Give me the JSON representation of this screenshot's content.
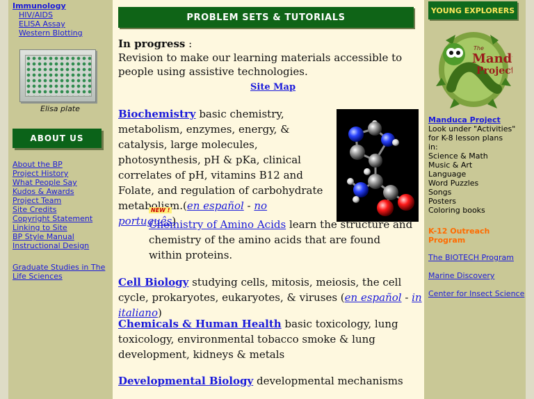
{
  "left_sidebar": {
    "immunology": {
      "title": "Immunology",
      "links": [
        "HIV/AIDS",
        "ELISA Assay",
        "Western Blotting"
      ]
    },
    "elisa_caption": "Elisa plate",
    "about_header": "ABOUT US",
    "about_links": [
      "About the BP",
      "Project History",
      "What People Say",
      "Kudos & Awards",
      "Project Team",
      "Site Credits",
      "Copyright Statement",
      "Linking to Site",
      "BP Style Manual",
      "Instructional Design"
    ],
    "grad_link": "Graduate Studies in The Life Sciences"
  },
  "main": {
    "header": "PROBLEM SETS & TUTORIALS",
    "in_progress_title": "In progress",
    "in_progress_colon": " :",
    "in_progress_text": "Revision to make our learning materials accessible to people using assistive technologies.",
    "site_map": "Site Map",
    "biochemistry": {
      "title": "Biochemistry",
      "text": "basic chemistry, metabolism, enzymes, energy, & catalysis, large molecules, photosynthesis, pH & pKa, clinical correlates of pH, vitamins B12 and Folate, and regulation of carbohydrate metabolism.",
      "open_paren": "(",
      "lang1": "en español",
      "sep": " - ",
      "lang2": "no português",
      "close_paren": ")"
    },
    "amino": {
      "badge": "NEW !",
      "title": "Chemistry of Amino Acids",
      "text": "learn the structure and chemistry of the amino acids that are found within proteins."
    },
    "cell": {
      "title": "Cell Biology",
      "text": "studying cells, mitosis, meiosis, the cell cycle, prokaryotes, eukaryotes, & viruses",
      "open_paren": " (",
      "lang1": "en español",
      "sep": " - ",
      "lang2": "in italiano",
      "close_paren": ")"
    },
    "chemicals": {
      "title": "Chemicals & Human Health",
      "text": "basic toxicology, lung toxicology, environmental tobacco smoke & lung development, kidneys & metals"
    },
    "developmental": {
      "title": "Developmental Biology",
      "text": "developmental mechanisms"
    }
  },
  "right_sidebar": {
    "young_explorers": "YOUNG EXPLORERS",
    "manduca_logo_text": "The Manduca Project",
    "manduca_title": "Manduca Project",
    "manduca_lines": [
      "Look under \"Activities\"",
      "for K-8 lesson plans",
      "in:",
      "Science & Math",
      "Music & Art",
      "Language",
      "Word Puzzles",
      "Songs",
      "Posters",
      "Coloring books"
    ],
    "outreach": "K-12 Outreach Program",
    "links": [
      "The BIOTECH Program",
      "Marine Discovery",
      "Center for Insect Science"
    ]
  },
  "colors": {
    "header_green": "#0f6417",
    "sidebar_khaki": "#c9c896",
    "main_bg": "#fef8df",
    "link_blue": "#1a1adb",
    "outreach_orange": "#ff6b00",
    "yellow_text": "#fbe65b"
  }
}
